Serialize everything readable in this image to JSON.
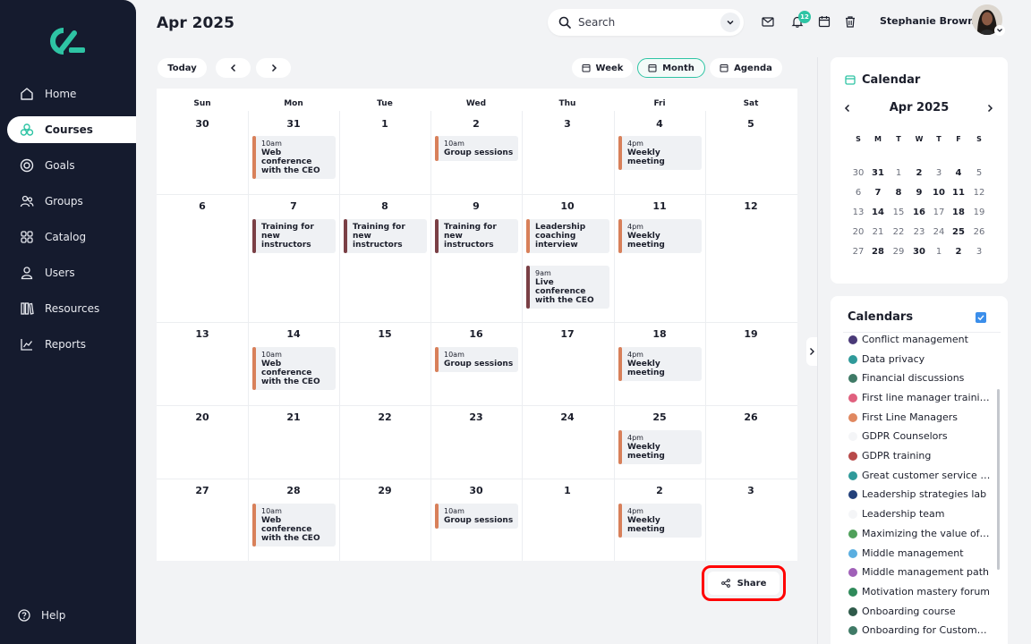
{
  "nav": {
    "items": [
      {
        "label": "Home",
        "icon": "home-icon"
      },
      {
        "label": "Courses",
        "icon": "courses-icon"
      },
      {
        "label": "Goals",
        "icon": "goals-icon"
      },
      {
        "label": "Groups",
        "icon": "groups-icon"
      },
      {
        "label": "Catalog",
        "icon": "catalog-icon"
      },
      {
        "label": "Users",
        "icon": "users-icon"
      },
      {
        "label": "Resources",
        "icon": "resources-icon"
      },
      {
        "label": "Reports",
        "icon": "reports-icon"
      }
    ],
    "active": "Courses",
    "help_label": "Help"
  },
  "header": {
    "title": "Apr 2025",
    "search_placeholder": "Search",
    "notification_count": "12",
    "user_name": "Stephanie Brown"
  },
  "toolbar": {
    "today_label": "Today",
    "views": {
      "week": "Week",
      "month": "Month",
      "agenda": "Agenda"
    },
    "active_view": "Month"
  },
  "calendar": {
    "weekdays": [
      "Sun",
      "Mon",
      "Tue",
      "Wed",
      "Thu",
      "Fri",
      "Sat"
    ],
    "weeks": [
      [
        "30",
        "31",
        "1",
        "2",
        "3",
        "4",
        "5"
      ],
      [
        "6",
        "7",
        "8",
        "9",
        "10",
        "11",
        "12"
      ],
      [
        "13",
        "14",
        "15",
        "16",
        "17",
        "18",
        "19"
      ],
      [
        "20",
        "21",
        "22",
        "23",
        "24",
        "25",
        "26"
      ],
      [
        "27",
        "28",
        "29",
        "30",
        "1",
        "2",
        "3"
      ]
    ],
    "events": [
      {
        "time": "10am",
        "title": "Web conference with the CEO"
      },
      {
        "time": "10am",
        "title": "Group sessions"
      },
      {
        "time": "4pm",
        "title": "Weekly meeting"
      },
      {
        "time": "",
        "title": "Training for new instructors"
      },
      {
        "time": "",
        "title": "Training for new instructors"
      },
      {
        "time": "",
        "title": "Training for new instructors"
      },
      {
        "time": "",
        "title": "Leadership coaching interview"
      },
      {
        "time": "9am",
        "title": "Live conference with the CEO"
      },
      {
        "time": "4pm",
        "title": "Weekly meeting"
      },
      {
        "time": "10am",
        "title": "Web conference with the CEO"
      },
      {
        "time": "10am",
        "title": "Group sessions"
      },
      {
        "time": "4pm",
        "title": "Weekly meeting"
      },
      {
        "time": "4pm",
        "title": "Weekly meeting"
      },
      {
        "time": "10am",
        "title": "Web conference with the CEO"
      },
      {
        "time": "10am",
        "title": "Group sessions"
      },
      {
        "time": "4pm",
        "title": "Weekly meeting"
      }
    ],
    "share_label": "Share"
  },
  "mini_calendar": {
    "title": "Calendar",
    "month": "Apr 2025",
    "weekdays": [
      "S",
      "M",
      "T",
      "W",
      "T",
      "F",
      "S"
    ],
    "weeks": [
      [
        "30",
        "31",
        "1",
        "2",
        "3",
        "4",
        "5"
      ],
      [
        "6",
        "7",
        "8",
        "9",
        "10",
        "11",
        "12"
      ],
      [
        "13",
        "14",
        "15",
        "16",
        "17",
        "18",
        "19"
      ],
      [
        "20",
        "21",
        "22",
        "23",
        "24",
        "25",
        "26"
      ],
      [
        "27",
        "28",
        "29",
        "30",
        "1",
        "2",
        "3"
      ]
    ]
  },
  "calendars": {
    "title": "Calendars",
    "items": [
      {
        "name": "Conflict management",
        "color": "#4a3a78"
      },
      {
        "name": "Data privacy",
        "color": "#2f9a9a"
      },
      {
        "name": "Financial discussions",
        "color": "#3f7a66"
      },
      {
        "name": "First line manager training",
        "color": "#e0607e"
      },
      {
        "name": "First Line Managers",
        "color": "#e08860"
      },
      {
        "name": "GDPR Counselors",
        "color": "#f4f5f7"
      },
      {
        "name": "GDPR training",
        "color": "#b84a4a"
      },
      {
        "name": "Great customer service e...",
        "color": "#2f9a9a"
      },
      {
        "name": "Leadership strategies lab",
        "color": "#23407a"
      },
      {
        "name": "Leadership team",
        "color": "#f4f5f7"
      },
      {
        "name": "Maximizing the value of ...",
        "color": "#4fa05a"
      },
      {
        "name": "Middle management",
        "color": "#5aaee0"
      },
      {
        "name": "Middle management path",
        "color": "#a060b8"
      },
      {
        "name": "Motivation mastery forum",
        "color": "#2f8a5a"
      },
      {
        "name": "Onboarding course",
        "color": "#2f5a4a"
      },
      {
        "name": "Onboarding for Custome...",
        "color": "#3f7a66"
      }
    ]
  },
  "colors": {
    "accent": "#2ec4a4",
    "sidebar": "#151b2e",
    "event_orange": "#d8805a",
    "event_maroon": "#7a3f45",
    "share_highlight": "#ff0000"
  }
}
